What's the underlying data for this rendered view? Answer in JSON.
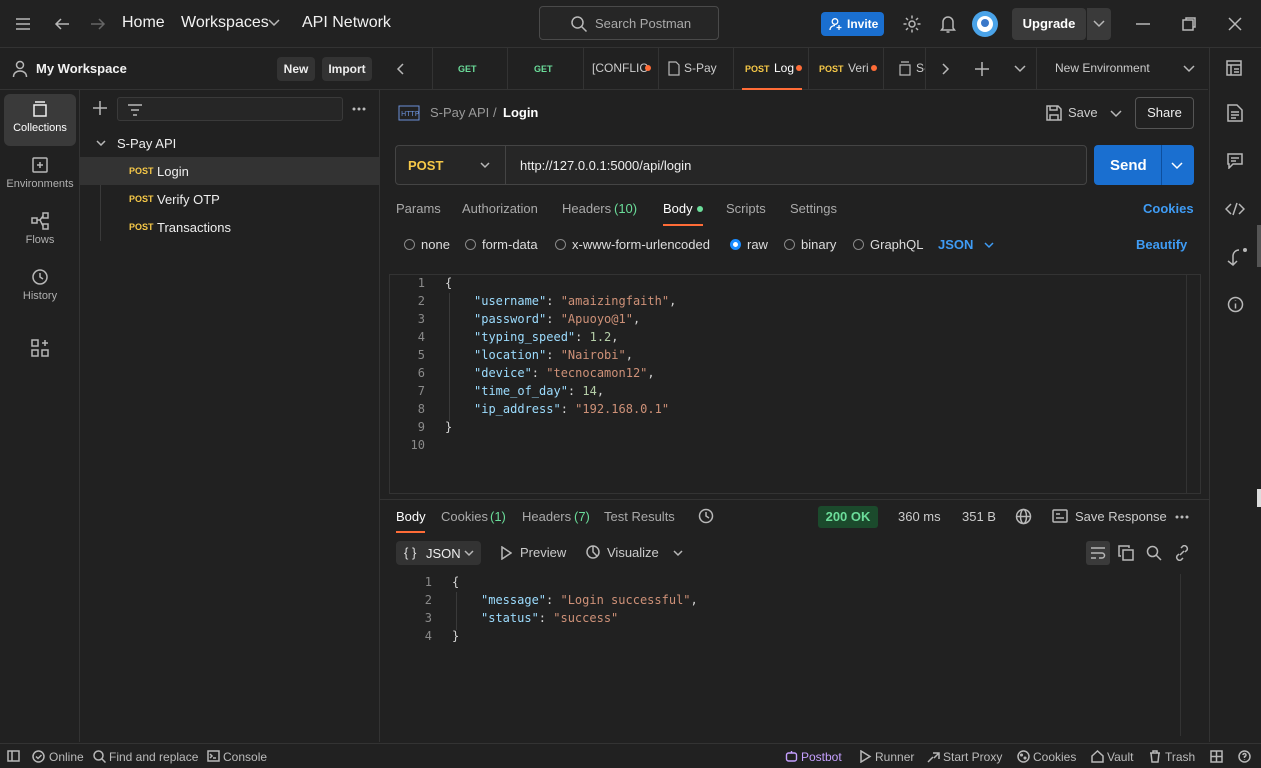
{
  "topbar": {
    "home": "Home",
    "workspaces": "Workspaces",
    "api_network": "API Network",
    "search_placeholder": "Search Postman",
    "invite": "Invite",
    "upgrade": "Upgrade"
  },
  "workspace": {
    "name": "My Workspace",
    "new_btn": "New",
    "import_btn": "Import"
  },
  "rail": {
    "items": [
      {
        "label": "Collections",
        "icon": "collections-icon"
      },
      {
        "label": "Environments",
        "icon": "environments-icon"
      },
      {
        "label": "Flows",
        "icon": "flows-icon"
      },
      {
        "label": "History",
        "icon": "history-icon"
      }
    ]
  },
  "sidebar": {
    "collection": "S-Pay API",
    "requests": [
      {
        "method": "POST",
        "name": "Login"
      },
      {
        "method": "POST",
        "name": "Verify OTP"
      },
      {
        "method": "POST",
        "name": "Transactions"
      }
    ]
  },
  "tabs": [
    {
      "method": "GET",
      "name": "",
      "color": "#6bdd9a"
    },
    {
      "method": "GET",
      "name": "",
      "color": "#6bdd9a"
    },
    {
      "method": "",
      "name": "[CONFLIC",
      "color": ""
    },
    {
      "method": "",
      "name": "S-Pay",
      "color": ""
    },
    {
      "method": "POST",
      "name": "Log",
      "color": "#f7c948"
    },
    {
      "method": "POST",
      "name": "Veri",
      "color": "#f7c948"
    },
    {
      "method": "",
      "name": "S-",
      "color": ""
    }
  ],
  "environment": "New Environment",
  "request": {
    "breadcrumb_parent": "S-Pay API",
    "breadcrumb_sep": "/",
    "title": "Login",
    "save": "Save",
    "share": "Share",
    "method": "POST",
    "url": "http://127.0.0.1:5000/api/login",
    "send": "Send",
    "tabs": {
      "params": "Params",
      "authorization": "Authorization",
      "headers": "Headers",
      "headers_count": "(10)",
      "body": "Body",
      "scripts": "Scripts",
      "settings": "Settings",
      "cookies": "Cookies"
    },
    "body_types": {
      "none": "none",
      "form_data": "form-data",
      "urlencoded": "x-www-form-urlencoded",
      "raw": "raw",
      "binary": "binary",
      "graphql": "GraphQL",
      "format": "JSON",
      "beautify": "Beautify"
    },
    "line_numbers": [
      "1",
      "2",
      "3",
      "4",
      "5",
      "6",
      "7",
      "8",
      "9",
      "10"
    ],
    "body_lines": {
      "open": "{",
      "close": "}",
      "fields": [
        {
          "key": "\"username\"",
          "value": "\"amaizingfaith\"",
          "type": "s",
          "comma": ","
        },
        {
          "key": "\"password\"",
          "value": "\"Apuoyo@1\"",
          "type": "s",
          "comma": ","
        },
        {
          "key": "\"typing_speed\"",
          "value": "1.2",
          "type": "n",
          "comma": ","
        },
        {
          "key": "\"location\"",
          "value": "\"Nairobi\"",
          "type": "s",
          "comma": ","
        },
        {
          "key": "\"device\"",
          "value": "\"tecnocamon12\"",
          "type": "s",
          "comma": ","
        },
        {
          "key": "\"time_of_day\"",
          "value": "14",
          "type": "n",
          "comma": ","
        },
        {
          "key": "\"ip_address\"",
          "value": "\"192.168.0.1\"",
          "type": "s",
          "comma": ""
        }
      ]
    }
  },
  "response": {
    "tabs": {
      "body": "Body",
      "cookies": "Cookies",
      "cookies_count": "(1)",
      "headers": "Headers",
      "headers_count": "(7)",
      "test_results": "Test Results"
    },
    "status": "200 OK",
    "time": "360 ms",
    "size": "351 B",
    "save_response": "Save Response",
    "format": "JSON",
    "preview": "Preview",
    "visualize": "Visualize",
    "line_numbers": [
      "1",
      "2",
      "3",
      "4"
    ],
    "body_lines": {
      "open": "{",
      "close": "}",
      "fields": [
        {
          "key": "\"message\"",
          "value": "\"Login successful\"",
          "comma": ","
        },
        {
          "key": "\"status\"",
          "value": "\"success\"",
          "comma": ""
        }
      ]
    }
  },
  "statusbar": {
    "online": "Online",
    "find_replace": "Find and replace",
    "console": "Console",
    "postbot": "Postbot",
    "runner": "Runner",
    "start_proxy": "Start Proxy",
    "cookies": "Cookies",
    "vault": "Vault",
    "trash": "Trash"
  },
  "colors": {
    "accent": "#1a6fd0",
    "link": "#3f9cf5",
    "post": "#f7c948",
    "get": "#6bdd9a",
    "status_ok": "#6bdd9a",
    "unsaved_dot": "#ff6c37",
    "postbot": "#c6a0ff"
  }
}
